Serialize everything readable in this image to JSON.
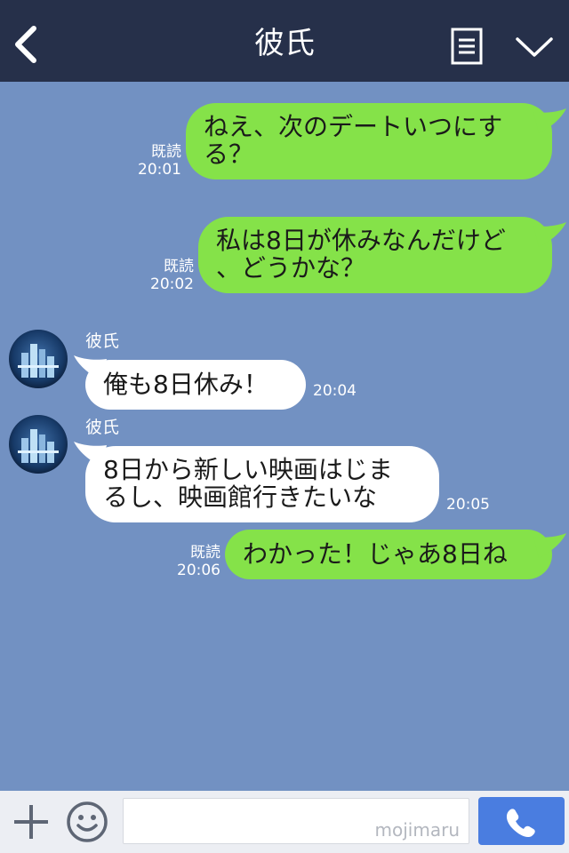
{
  "header": {
    "title": "彼氏",
    "icons": {
      "back": "chevron-left-icon",
      "note": "note-icon",
      "menu": "chevron-down-icon"
    }
  },
  "colors": {
    "header_bg": "#26304a",
    "chat_bg": "#7291c2",
    "my_bubble": "#85e249",
    "their_bubble": "#ffffff",
    "call_button": "#4a7de0",
    "footer_bg": "#eceef3"
  },
  "messages": [
    {
      "side": "me",
      "lines": [
        "ねえ、次のデートいつにす",
        "る？"
      ],
      "read": "既読",
      "time": "20:01"
    },
    {
      "side": "me",
      "lines": [
        "私は8日が休みなんだけど",
        "、どうかな？"
      ],
      "read": "既読",
      "time": "20:02"
    },
    {
      "side": "them",
      "sender": "彼氏",
      "lines": [
        "俺も8日休み！"
      ],
      "time": "20:04"
    },
    {
      "side": "them",
      "sender": "彼氏",
      "lines": [
        "8日から新しい映画はじま",
        "るし、映画館行きたいな"
      ],
      "time": "20:05"
    },
    {
      "side": "me",
      "lines": [
        "わかった！じゃあ8日ね"
      ],
      "read": "既読",
      "time": "20:06"
    }
  ],
  "footer": {
    "input_value": "",
    "watermark": "mojimaru",
    "icons": {
      "add": "plus-icon",
      "emoji": "smiley-icon",
      "call": "phone-icon"
    }
  }
}
